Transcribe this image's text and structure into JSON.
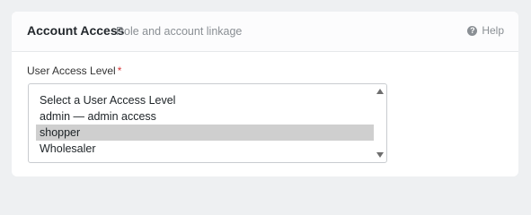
{
  "panel": {
    "title": "Account Access",
    "subtitle": "Role and account linkage",
    "help_label": "Help",
    "help_icon": "question-circle-icon"
  },
  "field": {
    "label": "User Access Level",
    "required_marker": "*",
    "options": [
      {
        "label": "Select a User Access Level",
        "selected": false
      },
      {
        "label": "admin — admin access",
        "selected": false
      },
      {
        "label": "shopper",
        "selected": true
      },
      {
        "label": "Wholesaler",
        "selected": false
      }
    ]
  },
  "colors": {
    "required": "#d63638",
    "selected_option_bg": "#cfcfcf",
    "page_bg": "#eef0f2"
  }
}
